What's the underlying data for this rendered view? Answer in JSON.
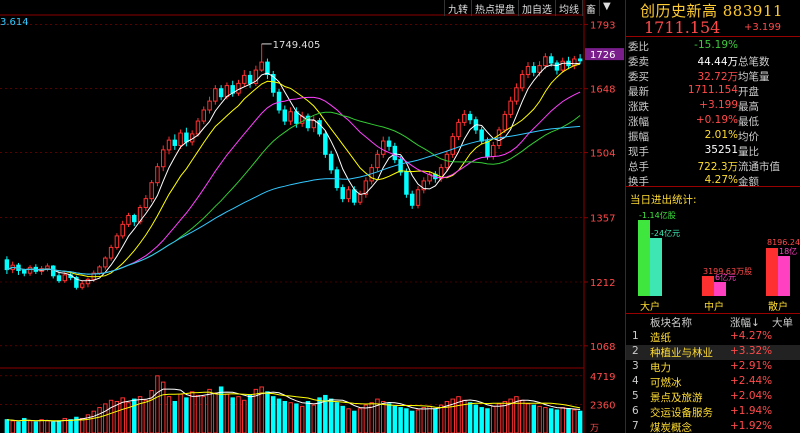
{
  "toolbar": [
    "九转",
    "热点提盘",
    "加自选",
    "均线",
    "畜",
    "▼"
  ],
  "info": {
    "title": "创历史新高 883911",
    "price": "1711.154",
    "change": "+3.199",
    "rows": [
      {
        "label": "委比",
        "value": "-15.19%",
        "value_color": "green",
        "label2": ""
      },
      {
        "label": "委卖",
        "value": "44.44万",
        "value_color": "white",
        "label2": "总笔数"
      },
      {
        "label": "委买",
        "value": "32.72万",
        "value_color": "red",
        "label2": "均笔量"
      },
      {
        "label": "最新",
        "value": "1711.154",
        "value_color": "red",
        "label2": "开盘"
      },
      {
        "label": "涨跌",
        "value": "+3.199",
        "value_color": "red",
        "label2": "最高"
      },
      {
        "label": "涨幅",
        "value": "+0.19%",
        "value_color": "red",
        "label2": "最低"
      },
      {
        "label": "振幅",
        "value": "2.01%",
        "value_color": "yellow",
        "label2": "均价"
      },
      {
        "label": "现手",
        "value": "35251",
        "value_color": "white",
        "label2": "量比"
      },
      {
        "label": "总手",
        "value": "722.3万",
        "value_color": "yellow",
        "label2": "流通市值"
      },
      {
        "label": "换手",
        "value": "4.27%",
        "value_color": "yellow",
        "label2": "金额"
      }
    ]
  },
  "flow": {
    "title": "当日进出统计:",
    "bars": [
      {
        "category": "大户",
        "label1": "-1.14亿股",
        "label2": "-24亿元",
        "v1": 0.95,
        "v2": 0.72,
        "c1": "#3ee63e",
        "c2": "#3ee6b4",
        "lc1": "#3ee63e",
        "lc2": "#3ee6b4"
      },
      {
        "category": "中户",
        "label1": "3199.63万股",
        "label2": "6亿元",
        "v1": 0.25,
        "v2": 0.18,
        "c1": "#ff3030",
        "c2": "#ff40c0",
        "lc1": "#ff4a4a",
        "lc2": "#ff40c0"
      },
      {
        "category": "散户",
        "label1": "8196.24",
        "label2": "18亿",
        "v1": 0.6,
        "v2": 0.5,
        "c1": "#ff3030",
        "c2": "#ff40c0",
        "lc1": "#ff4a4a",
        "lc2": "#ff40c0"
      }
    ]
  },
  "sectors": {
    "headers": [
      "板块名称",
      "涨幅↓",
      "大单"
    ],
    "items": [
      {
        "rank": "1",
        "name": "造纸",
        "change": "+4.27%"
      },
      {
        "rank": "2",
        "name": "种植业与林业",
        "change": "+3.32%"
      },
      {
        "rank": "3",
        "name": "电力",
        "change": "+2.91%"
      },
      {
        "rank": "4",
        "name": "可燃冰",
        "change": "+2.44%"
      },
      {
        "rank": "5",
        "name": "景点及旅游",
        "change": "+2.04%"
      },
      {
        "rank": "6",
        "name": "交运设备服务",
        "change": "+1.94%"
      },
      {
        "rank": "7",
        "name": "煤炭概念",
        "change": "+1.92%"
      }
    ]
  },
  "colors": {
    "up": "#ff3030",
    "down": "#00ffff",
    "grid": "#8b0000",
    "axis_text": "#ff4a4a",
    "ma1": "#ffffff",
    "ma2": "#ffff00",
    "ma3": "#ff40ff",
    "ma4": "#33cc33",
    "ma5": "#33c8ff"
  },
  "chart_data": {
    "type": "candlestick",
    "title": "",
    "annotations": [
      {
        "text": "3.614",
        "note": "partial price label at left edge"
      },
      {
        "text": "1749.405",
        "note": "period high marker"
      }
    ],
    "current_price_label": "1726",
    "price_axis": {
      "ticks": [
        1793,
        1726,
        1648,
        1504,
        1357,
        1212,
        1068
      ],
      "ylim": [
        1018,
        1812
      ]
    },
    "volume_axis": {
      "ticks": [
        4719,
        2360
      ],
      "unit": "万"
    },
    "candles": [
      [
        1262,
        1240,
        1270,
        1230
      ],
      [
        1240,
        1250,
        1258,
        1232
      ],
      [
        1250,
        1238,
        1255,
        1228
      ],
      [
        1238,
        1232,
        1242,
        1225
      ],
      [
        1232,
        1245,
        1250,
        1226
      ],
      [
        1245,
        1236,
        1252,
        1230
      ],
      [
        1236,
        1242,
        1248,
        1228
      ],
      [
        1242,
        1248,
        1254,
        1236
      ],
      [
        1248,
        1226,
        1250,
        1220
      ],
      [
        1226,
        1215,
        1232,
        1210
      ],
      [
        1215,
        1228,
        1234,
        1210
      ],
      [
        1228,
        1222,
        1232,
        1216
      ],
      [
        1222,
        1200,
        1226,
        1195
      ],
      [
        1200,
        1208,
        1215,
        1195
      ],
      [
        1208,
        1218,
        1222,
        1200
      ],
      [
        1218,
        1232,
        1238,
        1212
      ],
      [
        1232,
        1246,
        1250,
        1228
      ],
      [
        1246,
        1266,
        1270,
        1240
      ],
      [
        1266,
        1290,
        1296,
        1260
      ],
      [
        1290,
        1316,
        1322,
        1285
      ],
      [
        1316,
        1342,
        1350,
        1310
      ],
      [
        1342,
        1362,
        1368,
        1336
      ],
      [
        1362,
        1348,
        1366,
        1338
      ],
      [
        1348,
        1380,
        1386,
        1342
      ],
      [
        1380,
        1400,
        1408,
        1372
      ],
      [
        1400,
        1436,
        1442,
        1392
      ],
      [
        1436,
        1472,
        1480,
        1428
      ],
      [
        1472,
        1510,
        1520,
        1462
      ],
      [
        1510,
        1532,
        1540,
        1500
      ],
      [
        1532,
        1520,
        1545,
        1510
      ],
      [
        1520,
        1548,
        1556,
        1512
      ],
      [
        1548,
        1528,
        1560,
        1518
      ],
      [
        1528,
        1546,
        1554,
        1520
      ],
      [
        1546,
        1575,
        1582,
        1540
      ],
      [
        1575,
        1600,
        1608,
        1568
      ],
      [
        1600,
        1620,
        1630,
        1592
      ],
      [
        1620,
        1648,
        1656,
        1612
      ],
      [
        1648,
        1630,
        1656,
        1622
      ],
      [
        1630,
        1655,
        1662,
        1624
      ],
      [
        1655,
        1638,
        1666,
        1630
      ],
      [
        1638,
        1660,
        1668,
        1632
      ],
      [
        1660,
        1678,
        1690,
        1652
      ],
      [
        1678,
        1660,
        1688,
        1650
      ],
      [
        1660,
        1690,
        1700,
        1654
      ],
      [
        1690,
        1708,
        1749,
        1686
      ],
      [
        1708,
        1680,
        1716,
        1670
      ],
      [
        1680,
        1640,
        1688,
        1630
      ],
      [
        1640,
        1600,
        1648,
        1592
      ],
      [
        1600,
        1575,
        1610,
        1566
      ],
      [
        1575,
        1596,
        1606,
        1566
      ],
      [
        1596,
        1570,
        1606,
        1560
      ],
      [
        1570,
        1586,
        1596,
        1562
      ],
      [
        1586,
        1560,
        1592,
        1552
      ],
      [
        1560,
        1576,
        1586,
        1550
      ],
      [
        1576,
        1546,
        1582,
        1540
      ],
      [
        1546,
        1500,
        1552,
        1492
      ],
      [
        1500,
        1465,
        1508,
        1456
      ],
      [
        1465,
        1425,
        1472,
        1418
      ],
      [
        1425,
        1400,
        1432,
        1392
      ],
      [
        1400,
        1420,
        1428,
        1392
      ],
      [
        1420,
        1392,
        1428,
        1385
      ],
      [
        1392,
        1410,
        1418,
        1386
      ],
      [
        1410,
        1440,
        1448,
        1402
      ],
      [
        1440,
        1470,
        1478,
        1432
      ],
      [
        1470,
        1500,
        1510,
        1462
      ],
      [
        1500,
        1530,
        1540,
        1492
      ],
      [
        1530,
        1518,
        1540,
        1508
      ],
      [
        1518,
        1488,
        1526,
        1480
      ],
      [
        1488,
        1460,
        1496,
        1452
      ],
      [
        1460,
        1410,
        1468,
        1402
      ],
      [
        1410,
        1385,
        1418,
        1377
      ],
      [
        1385,
        1420,
        1428,
        1378
      ],
      [
        1420,
        1440,
        1448,
        1412
      ],
      [
        1440,
        1455,
        1462,
        1432
      ],
      [
        1455,
        1445,
        1462,
        1436
      ],
      [
        1445,
        1470,
        1478,
        1438
      ],
      [
        1470,
        1500,
        1508,
        1462
      ],
      [
        1500,
        1540,
        1548,
        1492
      ],
      [
        1540,
        1572,
        1580,
        1532
      ],
      [
        1572,
        1590,
        1600,
        1564
      ],
      [
        1590,
        1578,
        1598,
        1568
      ],
      [
        1578,
        1555,
        1585,
        1546
      ],
      [
        1555,
        1530,
        1562,
        1522
      ],
      [
        1530,
        1495,
        1538,
        1488
      ],
      [
        1495,
        1520,
        1528,
        1488
      ],
      [
        1520,
        1555,
        1562,
        1512
      ],
      [
        1555,
        1590,
        1598,
        1548
      ],
      [
        1590,
        1620,
        1630,
        1582
      ],
      [
        1620,
        1650,
        1660,
        1612
      ],
      [
        1650,
        1680,
        1690,
        1642
      ],
      [
        1680,
        1698,
        1708,
        1672
      ],
      [
        1698,
        1685,
        1708,
        1676
      ],
      [
        1685,
        1700,
        1710,
        1676
      ],
      [
        1700,
        1720,
        1728,
        1692
      ],
      [
        1720,
        1706,
        1728,
        1698
      ],
      [
        1706,
        1690,
        1712,
        1680
      ],
      [
        1690,
        1710,
        1718,
        1684
      ],
      [
        1710,
        1700,
        1720,
        1692
      ],
      [
        1700,
        1715,
        1722,
        1692
      ],
      [
        1715,
        1711,
        1726,
        1704
      ]
    ],
    "volume": [
      1100,
      1000,
      900,
      1200,
      1000,
      900,
      1100,
      1000,
      900,
      1000,
      1200,
      1100,
      1300,
      1200,
      1500,
      1800,
      2100,
      2400,
      2700,
      2600,
      2900,
      2500,
      2800,
      3000,
      2700,
      3500,
      4719,
      4200,
      3000,
      2600,
      3200,
      2900,
      3400,
      3100,
      3000,
      3600,
      3300,
      3800,
      3200,
      2900,
      3000,
      2700,
      3100,
      3600,
      3800,
      3400,
      3000,
      2800,
      2600,
      2500,
      2400,
      2200,
      2600,
      2300,
      2900,
      3100,
      2800,
      2500,
      2200,
      2000,
      1800,
      2000,
      2300,
      2500,
      2800,
      2600,
      2400,
      2200,
      2100,
      2000,
      1800,
      1900,
      2100,
      2200,
      2000,
      2300,
      2600,
      2800,
      3000,
      2700,
      2500,
      2300,
      2100,
      2000,
      2200,
      2400,
      2600,
      2800,
      3000,
      2700,
      2400,
      2300,
      2200,
      2100,
      2000,
      1900,
      2100,
      2000,
      1900,
      1800
    ]
  }
}
